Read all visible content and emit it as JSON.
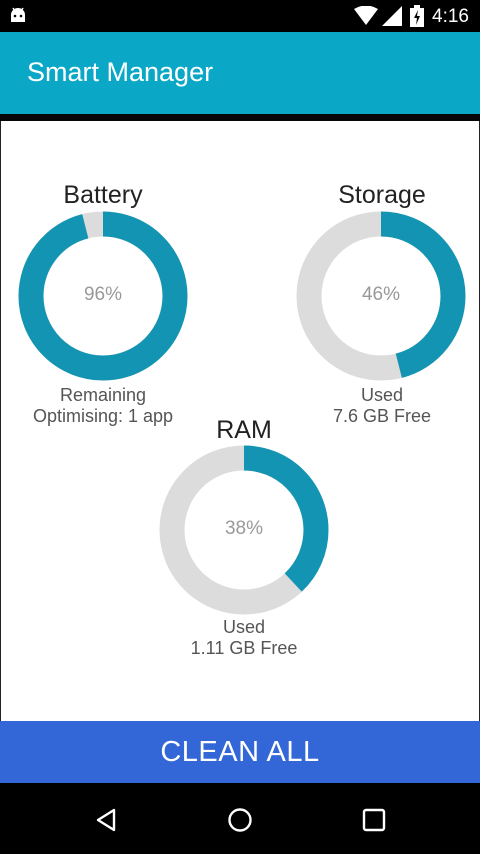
{
  "status_bar": {
    "time": "4:16",
    "icons": [
      "android-icon",
      "wifi-icon",
      "signal-icon",
      "battery-icon"
    ]
  },
  "app_bar": {
    "title": "Smart Manager"
  },
  "battery": {
    "title": "Battery",
    "percent_text": "96%",
    "fraction": 0.96,
    "caption_line1": "Remaining",
    "caption_line2": "Optimising: 1 app"
  },
  "storage": {
    "title": "Storage",
    "percent_text": "46%",
    "fraction": 0.46,
    "caption_line1": "Used",
    "caption_line2": "7.6 GB Free"
  },
  "ram": {
    "title": "RAM",
    "percent_text": "38%",
    "fraction": 0.38,
    "caption_line1": "Used",
    "caption_line2": "1.11 GB Free"
  },
  "clean_button": {
    "label": "CLEAN ALL"
  },
  "nav_bar": {
    "buttons": [
      "back-icon",
      "home-icon",
      "recents-icon"
    ]
  },
  "colors": {
    "accent": "#0aa8c6",
    "ring_fill": "#1394b3",
    "ring_track": "#dcdcdc",
    "button": "#3366d6"
  }
}
